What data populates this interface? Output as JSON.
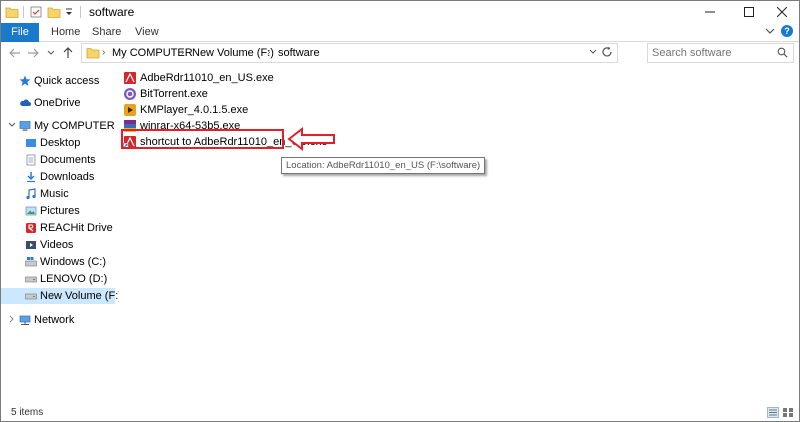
{
  "window": {
    "title": "software"
  },
  "ribbon": {
    "tabs": [
      {
        "label": "File"
      },
      {
        "label": "Home"
      },
      {
        "label": "Share"
      },
      {
        "label": "View"
      }
    ]
  },
  "address_bar": {
    "crumbs": [
      "My COMPUTER",
      "New Volume (F:)",
      "software"
    ]
  },
  "search": {
    "placeholder": "Search software"
  },
  "navigation_pane": {
    "items": [
      {
        "label": "Quick access",
        "icon": "star-icon"
      },
      {
        "label": "OneDrive",
        "icon": "cloud-icon"
      },
      {
        "label": "My COMPUTER",
        "icon": "computer-icon"
      },
      {
        "label": "Desktop",
        "icon": "desktop-folder-icon"
      },
      {
        "label": "Documents",
        "icon": "documents-folder-icon"
      },
      {
        "label": "Downloads",
        "icon": "downloads-folder-icon"
      },
      {
        "label": "Music",
        "icon": "music-folder-icon"
      },
      {
        "label": "Pictures",
        "icon": "pictures-folder-icon"
      },
      {
        "label": "REACHit Drive",
        "icon": "reachit-drive-icon"
      },
      {
        "label": "Videos",
        "icon": "videos-folder-icon"
      },
      {
        "label": "Windows (C:)",
        "icon": "windows-drive-icon"
      },
      {
        "label": "LENOVO (D:)",
        "icon": "drive-icon"
      },
      {
        "label": "New Volume (F:)",
        "icon": "drive-icon"
      },
      {
        "label": "Network",
        "icon": "network-icon"
      }
    ]
  },
  "files": [
    {
      "name": "AdbeRdr11010_en_US.exe",
      "icon": "adobe-reader-icon"
    },
    {
      "name": "BitTorrent.exe",
      "icon": "bittorrent-icon"
    },
    {
      "name": "KMPlayer_4.0.1.5.exe",
      "icon": "kmplayer-icon"
    },
    {
      "name": "winrar-x64-53b5.exe",
      "icon": "winrar-icon"
    },
    {
      "name": "shortcut to AdbeRdr11010_en_US.exe",
      "icon": "adobe-shortcut-icon"
    }
  ],
  "tooltip": {
    "text": "Location: AdbeRdr11010_en_US (F:\\software)"
  },
  "status_bar": {
    "item_count": "5 items"
  },
  "colors": {
    "file_tab": "#1979ca",
    "selection": "#cce8ff",
    "annotation": "#e3202a"
  }
}
